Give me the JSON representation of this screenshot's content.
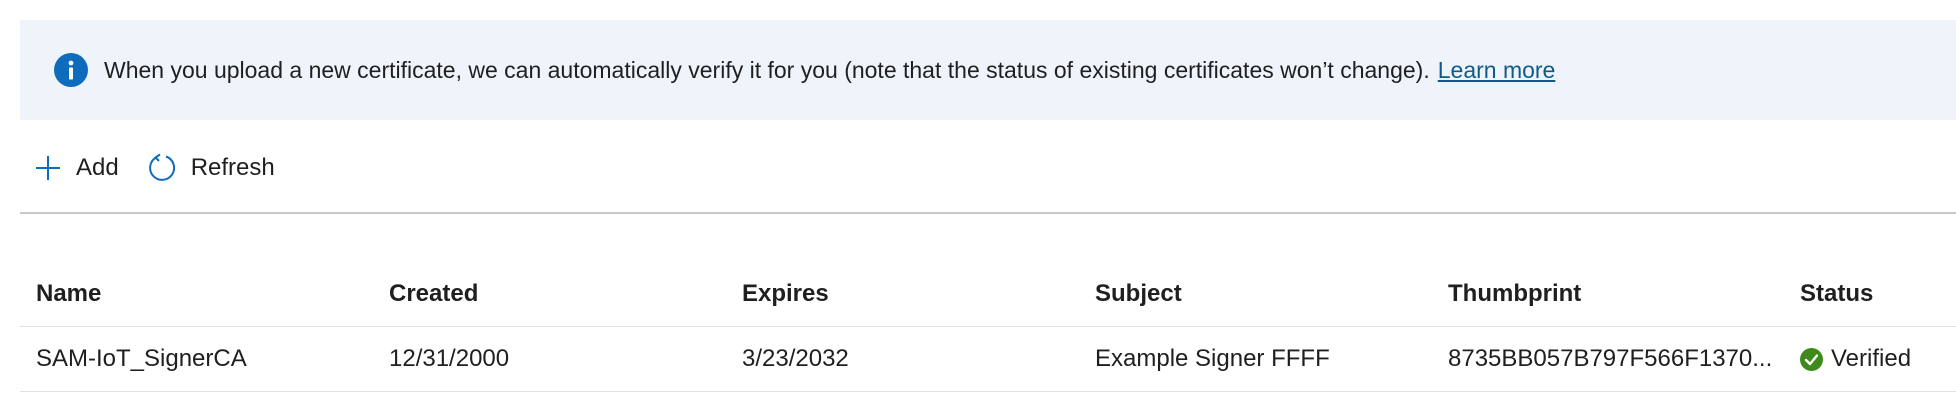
{
  "banner": {
    "icon": "info-icon",
    "text": "When you upload a new certificate, we can automatically verify it for you (note that the status of existing certificates won’t change).",
    "link_text": "Learn more"
  },
  "toolbar": {
    "add_label": "Add",
    "add_icon": "plus-icon",
    "refresh_label": "Refresh",
    "refresh_icon": "refresh-icon"
  },
  "table": {
    "columns": [
      "Name",
      "Created",
      "Expires",
      "Subject",
      "Thumbprint",
      "Status"
    ],
    "rows": [
      {
        "name": "SAM-IoT_SignerCA",
        "created": "12/31/2000",
        "expires": "3/23/2032",
        "subject": "Example Signer FFFF",
        "thumbprint": "8735BB057B797F566F1370...",
        "status": "Verified",
        "status_icon": "checkmark-circle-icon"
      }
    ]
  },
  "colors": {
    "accent": "#0f6cbd",
    "banner_bg": "#eff4fb",
    "success": "#3f8a1d"
  }
}
